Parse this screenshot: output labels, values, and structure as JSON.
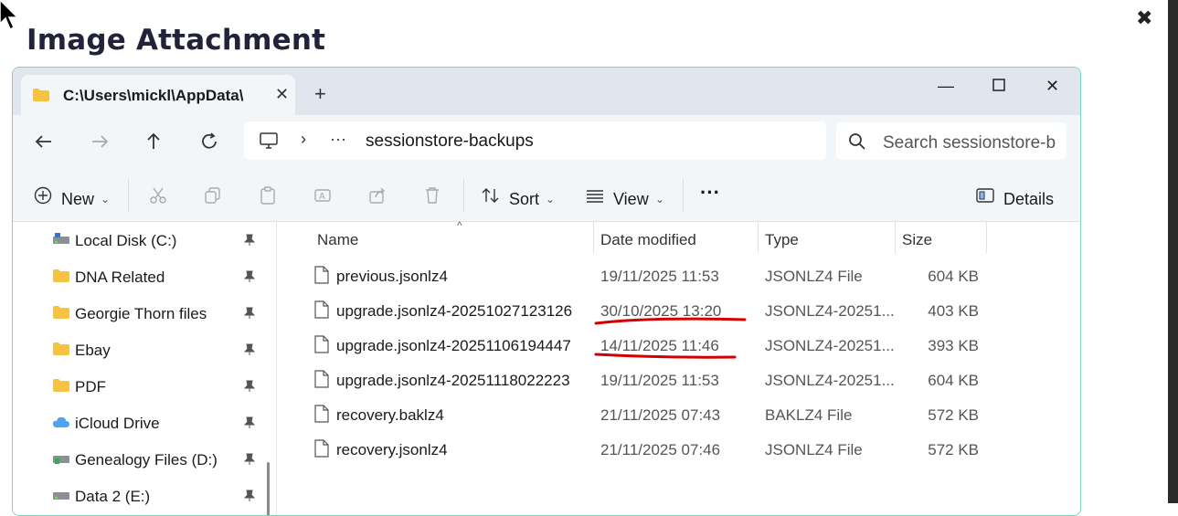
{
  "dialog": {
    "title": "Image Attachment"
  },
  "window": {
    "tab": {
      "label": "C:\\Users\\mickl\\AppData\\"
    },
    "address": {
      "current": "sessionstore-backups",
      "ellipsis": "···"
    },
    "search": {
      "placeholder": "Search sessionstore-b"
    }
  },
  "toolbar": {
    "new_label": "New",
    "sort_label": "Sort",
    "view_label": "View",
    "more_label": "···",
    "details_label": "Details"
  },
  "sidebar": {
    "items": [
      {
        "label": "Local Disk (C:)",
        "icon": "drive-icon"
      },
      {
        "label": "DNA Related",
        "icon": "folder-icon"
      },
      {
        "label": "Georgie Thorn files",
        "icon": "folder-icon"
      },
      {
        "label": "Ebay",
        "icon": "folder-icon"
      },
      {
        "label": "PDF",
        "icon": "folder-icon"
      },
      {
        "label": "iCloud Drive",
        "icon": "cloud-icon"
      },
      {
        "label": "Genealogy Files (D:)",
        "icon": "drive-icon"
      },
      {
        "label": "Data 2 (E:)",
        "icon": "drive-icon"
      }
    ]
  },
  "table": {
    "columns": [
      "Name",
      "Date modified",
      "Type",
      "Size"
    ],
    "rows": [
      {
        "name": "previous.jsonlz4",
        "date": "19/11/2025 11:53",
        "type": "JSONLZ4 File",
        "size": "604 KB"
      },
      {
        "name": "upgrade.jsonlz4-20251027123126",
        "date": "30/10/2025 13:20",
        "type": "JSONLZ4-20251...",
        "size": "403 KB"
      },
      {
        "name": "upgrade.jsonlz4-20251106194447",
        "date": "14/11/2025 11:46",
        "type": "JSONLZ4-20251...",
        "size": "393 KB"
      },
      {
        "name": "upgrade.jsonlz4-20251118022223",
        "date": "19/11/2025 11:53",
        "type": "JSONLZ4-20251...",
        "size": "604 KB"
      },
      {
        "name": "recovery.baklz4",
        "date": "21/11/2025 07:43",
        "type": "BAKLZ4 File",
        "size": "572 KB"
      },
      {
        "name": "recovery.jsonlz4",
        "date": "21/11/2025 07:46",
        "type": "JSONLZ4 File",
        "size": "572 KB"
      }
    ]
  },
  "colors": {
    "accent_border": "#7fd3b8",
    "annotation_red": "#d40000",
    "folder": "#f5c242"
  }
}
